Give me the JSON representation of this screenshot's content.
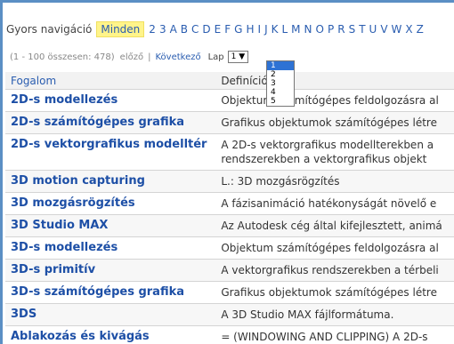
{
  "nav": {
    "label": "Gyors navigáció",
    "all": "Minden",
    "letters": [
      "2",
      "3",
      "A",
      "B",
      "C",
      "D",
      "E",
      "F",
      "G",
      "H",
      "I",
      "J",
      "K",
      "L",
      "M",
      "N",
      "O",
      "P",
      "R",
      "S",
      "T",
      "U",
      "V",
      "W",
      "X",
      "Z"
    ]
  },
  "pager": {
    "count": "(1 - 100 összesen: 478)",
    "prev": "előző",
    "separator": "|",
    "next": "Következő",
    "page_label": "Lap",
    "page_value": "1 ▼",
    "options": [
      "1",
      "2",
      "3",
      "4",
      "5"
    ]
  },
  "table": {
    "headers": [
      "Fogalom",
      "Definíció"
    ],
    "rows": [
      {
        "term": "2D-s modellezés",
        "def": "Objektum számítógépes feldolgozásra al"
      },
      {
        "term": "2D-s számítógépes grafika",
        "def": "Grafikus objektumok számítógépes létre"
      },
      {
        "term": "2D-s vektorgrafikus modelltér",
        "def": "A 2D-s vektorgrafikus modellterekben a rendszerekben a vektorgrafikus objekt"
      },
      {
        "term": "3D motion capturing",
        "def": "L.: 3D mozgásrögzítés"
      },
      {
        "term": "3D mozgásrögzítés",
        "def": "A fázisanimáció hatékonyságát növelő e"
      },
      {
        "term": "3D Studio MAX",
        "def": "Az Autodesk cég által kifejlesztett, animá"
      },
      {
        "term": "3D-s modellezés",
        "def": "Objektum számítógépes feldolgozásra al"
      },
      {
        "term": "3D-s primitív",
        "def": "A vektorgrafikus rendszerekben a térbeli"
      },
      {
        "term": "3D-s számítógépes grafika",
        "def": "Grafikus objektumok számítógépes létre"
      },
      {
        "term": "3DS",
        "def": "A 3D Studio MAX fájlformátuma."
      },
      {
        "term": "Ablakozás és kivágás",
        "def": "= (WINDOWING AND CLIPPING) A 2D-s"
      }
    ]
  }
}
